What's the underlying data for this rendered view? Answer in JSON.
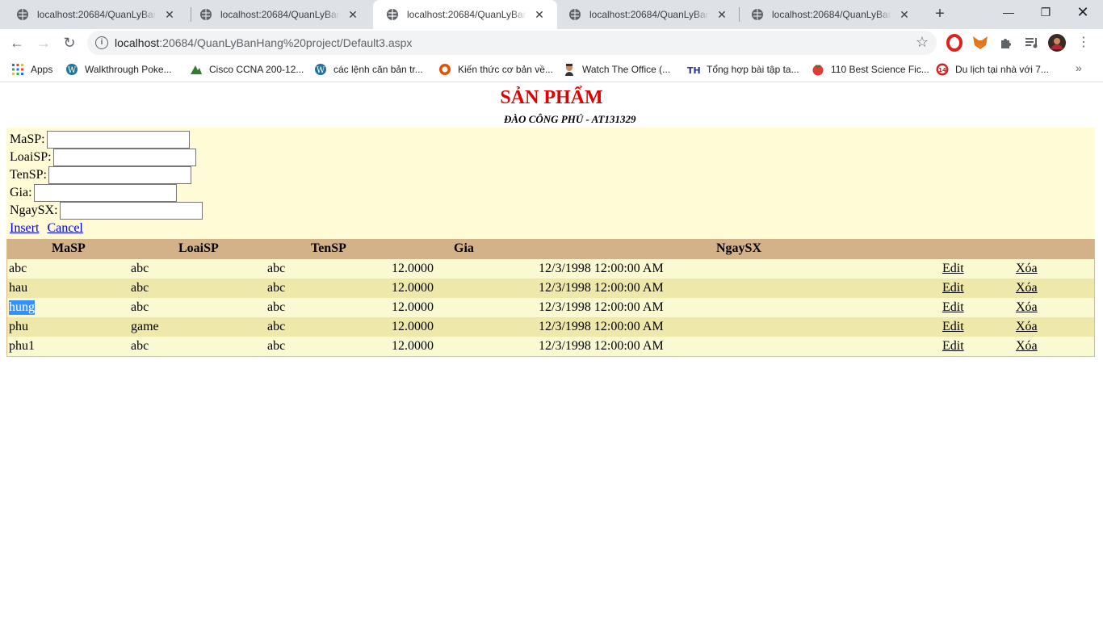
{
  "browser": {
    "tabs": [
      {
        "title": "localhost:20684/QuanLyBanHang",
        "active": false
      },
      {
        "title": "localhost:20684/QuanLyBanHang",
        "active": false
      },
      {
        "title": "localhost:20684/QuanLyBanHang",
        "active": true
      },
      {
        "title": "localhost:20684/QuanLyBanHang",
        "active": false
      },
      {
        "title": "localhost:20684/QuanLyBanHang",
        "active": false
      }
    ],
    "new_tab": "+",
    "url_host": "localhost",
    "url_rest": ":20684/QuanLyBanHang%20project/Default3.aspx",
    "bookmarks": [
      {
        "label": "Apps",
        "icon": "apps-grid-icon"
      },
      {
        "label": "Walkthrough Poke...",
        "icon": "wordpress-icon"
      },
      {
        "label": "Cisco CCNA 200-12...",
        "icon": "pa-logo-icon"
      },
      {
        "label": "các lệnh căn bản tr...",
        "icon": "wordpress-icon"
      },
      {
        "label": "Kiến thức cơ bản về...",
        "icon": "github-icon"
      },
      {
        "label": "Watch The Office (...",
        "icon": "person-icon"
      },
      {
        "label": "Tổng hợp bài tập ta...",
        "icon": "th-logo-icon"
      },
      {
        "label": "110 Best Science Fic...",
        "icon": "tomato-icon"
      },
      {
        "label": "Du lịch tại nhà với 7...",
        "icon": "badge-14-icon"
      }
    ]
  },
  "page": {
    "title": "SẢN PHẨM",
    "author": "ĐÀO CÔNG PHÚ - AT131329",
    "form": {
      "fields": [
        {
          "label": "MaSP:",
          "value": ""
        },
        {
          "label": "LoaiSP:",
          "value": ""
        },
        {
          "label": "TenSP:",
          "value": ""
        },
        {
          "label": "Gia:",
          "value": ""
        },
        {
          "label": "NgaySX:",
          "value": ""
        }
      ],
      "insert_label": "Insert",
      "cancel_label": "Cancel"
    },
    "grid": {
      "headers": [
        "MaSP",
        "LoaiSP",
        "TenSP",
        "Gia",
        "NgaySX"
      ],
      "edit_label": "Edit",
      "delete_label": "Xóa",
      "rows": [
        {
          "masp": "abc",
          "loaisp": "abc",
          "tensp": "abc",
          "gia": "12.0000",
          "ngaysx": "12/3/1998 12:00:00 AM"
        },
        {
          "masp": "hau",
          "loaisp": "abc",
          "tensp": "abc",
          "gia": "12.0000",
          "ngaysx": "12/3/1998 12:00:00 AM"
        },
        {
          "masp": "hung",
          "loaisp": "abc",
          "tensp": "abc",
          "gia": "12.0000",
          "ngaysx": "12/3/1998 12:00:00 AM"
        },
        {
          "masp": "phu",
          "loaisp": "game",
          "tensp": "abc",
          "gia": "12.0000",
          "ngaysx": "12/3/1998 12:00:00 AM"
        },
        {
          "masp": "phu1",
          "loaisp": "abc",
          "tensp": "abc",
          "gia": "12.0000",
          "ngaysx": "12/3/1998 12:00:00 AM"
        }
      ]
    }
  },
  "colors": {
    "title_red": "#e00000",
    "form_bg": "#fffbd6",
    "grid_header": "#d3b28a",
    "row_odd": "#fafad2",
    "row_even": "#eee8aa",
    "selection": "#3390ff"
  }
}
